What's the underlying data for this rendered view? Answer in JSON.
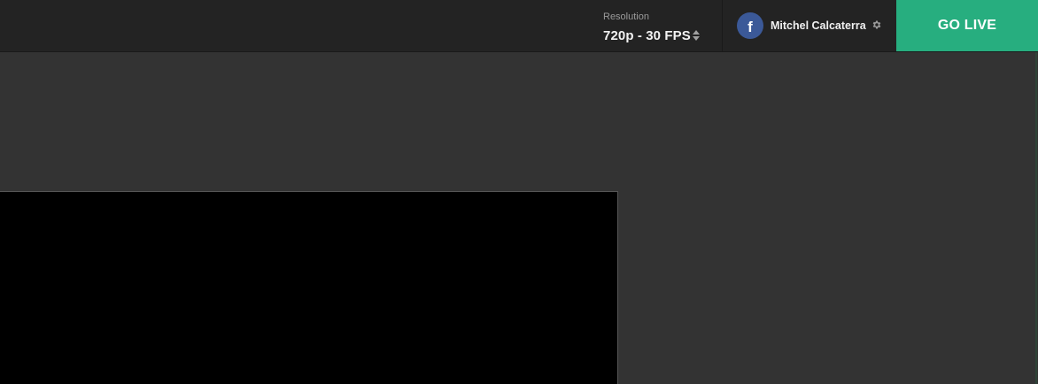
{
  "header": {
    "resolution": {
      "label": "Resolution",
      "value": "720p - 30 FPS",
      "icon": "sort-icon"
    },
    "account": {
      "name": "Mitchel Calcaterra",
      "platform_glyph": "f",
      "platform_icon": "facebook-icon",
      "settings_icon": "gear-icon"
    },
    "go_live_label": "GO LIVE"
  },
  "colors": {
    "topbar_bg": "#232323",
    "main_bg": "#333333",
    "accent_go_live": "#27ae7f",
    "facebook_blue": "#3b5998",
    "preview_bg": "#000000"
  }
}
